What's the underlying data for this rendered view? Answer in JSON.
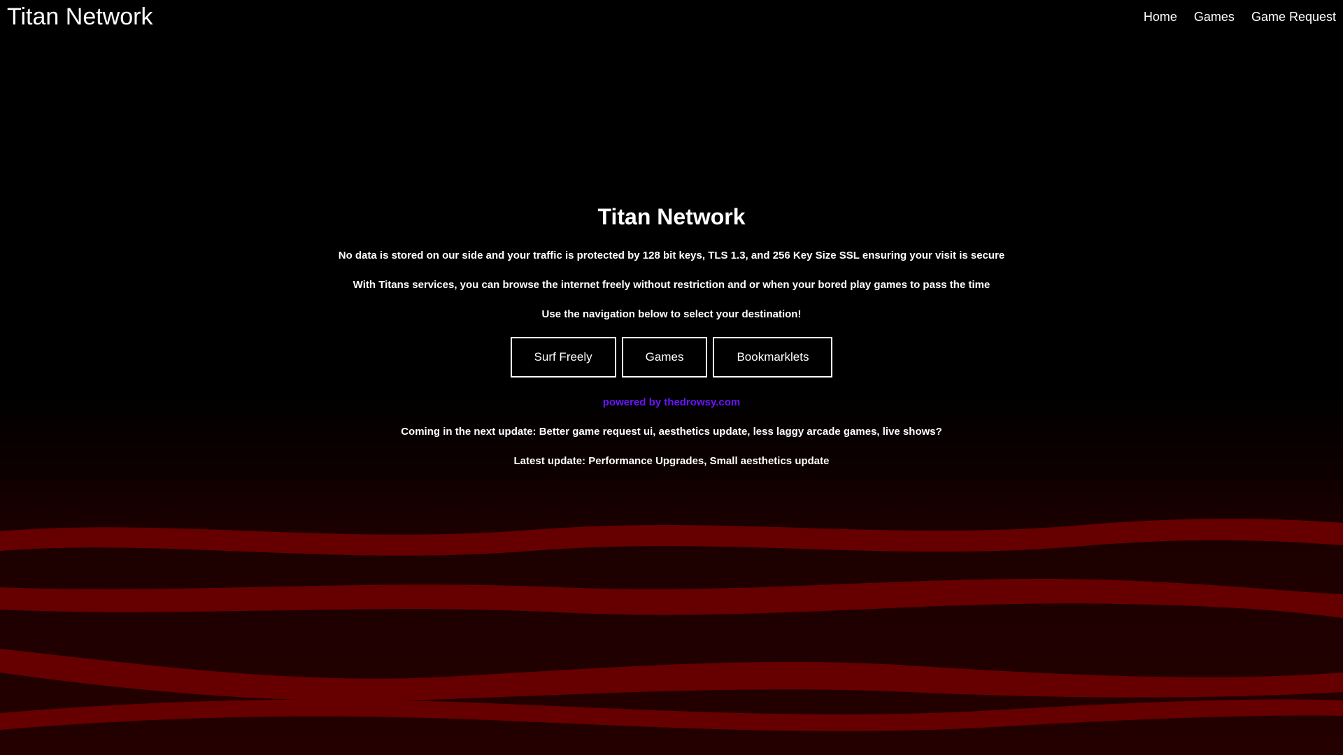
{
  "header": {
    "brand": "Titan Network",
    "nav": [
      "Home",
      "Games",
      "Game Request"
    ]
  },
  "main": {
    "title": "Titan Network",
    "lines": [
      "No data is stored on our side and your traffic is protected by 128 bit keys, TLS 1.3, and 256 Key Size SSL ensuring your visit is secure",
      "With Titans services, you can browse the internet freely without restriction and or when your bored play games to pass the time",
      "Use the navigation below to select your destination!"
    ],
    "buttons": [
      "Surf Freely",
      "Games",
      "Bookmarklets"
    ],
    "powered": "powered by thedrowsy.com",
    "next_update": "Coming in the next update: Better game request ui, aesthetics update, less laggy arcade games, live shows?",
    "latest_update": "Latest update: Performance Upgrades, Small aesthetics update"
  },
  "colors": {
    "background": "#000000",
    "wave": "#660000",
    "link": "#6a14ff",
    "text": "#ffffff"
  }
}
